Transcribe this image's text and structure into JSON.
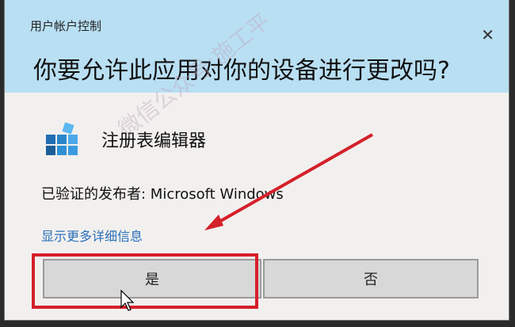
{
  "dialog": {
    "header_title": "用户帐户控制",
    "question": "你要允许此应用对你的设备进行更改吗?",
    "close_symbol": "✕"
  },
  "app": {
    "name": "注册表编辑器",
    "icon": "registry-editor-icon"
  },
  "publisher": {
    "text": "已验证的发布者: Microsoft Windows"
  },
  "details_link": "显示更多详细信息",
  "buttons": {
    "yes": "是",
    "no": "否"
  },
  "overlay": {
    "watermark": "微信公众号:施工平",
    "highlight_color": "#d4202a"
  },
  "colors": {
    "header_bg": "#b9dff3",
    "link": "#2a6fba"
  }
}
